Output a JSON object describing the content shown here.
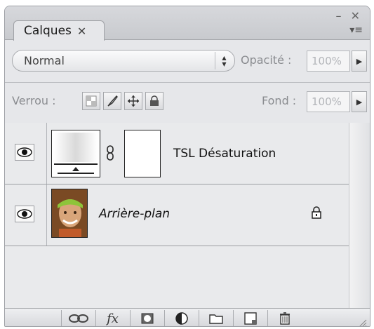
{
  "panel": {
    "tab_label": "Calques",
    "tab_close": "✕",
    "window_controls": "– ✕",
    "menu_icon": "▾≡"
  },
  "blend": {
    "mode": "Normal",
    "opacity_label": "Opacité :",
    "opacity_value": "100%"
  },
  "lock": {
    "label": "Verrou :",
    "fill_label": "Fond :",
    "fill_value": "100%"
  },
  "layers": [
    {
      "name": "TSL Désaturation",
      "visible": true,
      "type": "adjustment-with-mask"
    },
    {
      "name": "Arrière-plan",
      "visible": true,
      "type": "background",
      "locked": true
    }
  ],
  "bottom_buttons": [
    "link-layers",
    "layer-style-fx",
    "add-mask",
    "new-adjustment",
    "new-group",
    "new-layer",
    "delete-layer"
  ],
  "colors": {
    "panel_bg": "#e6e7ea",
    "border": "#9fa1a6"
  }
}
